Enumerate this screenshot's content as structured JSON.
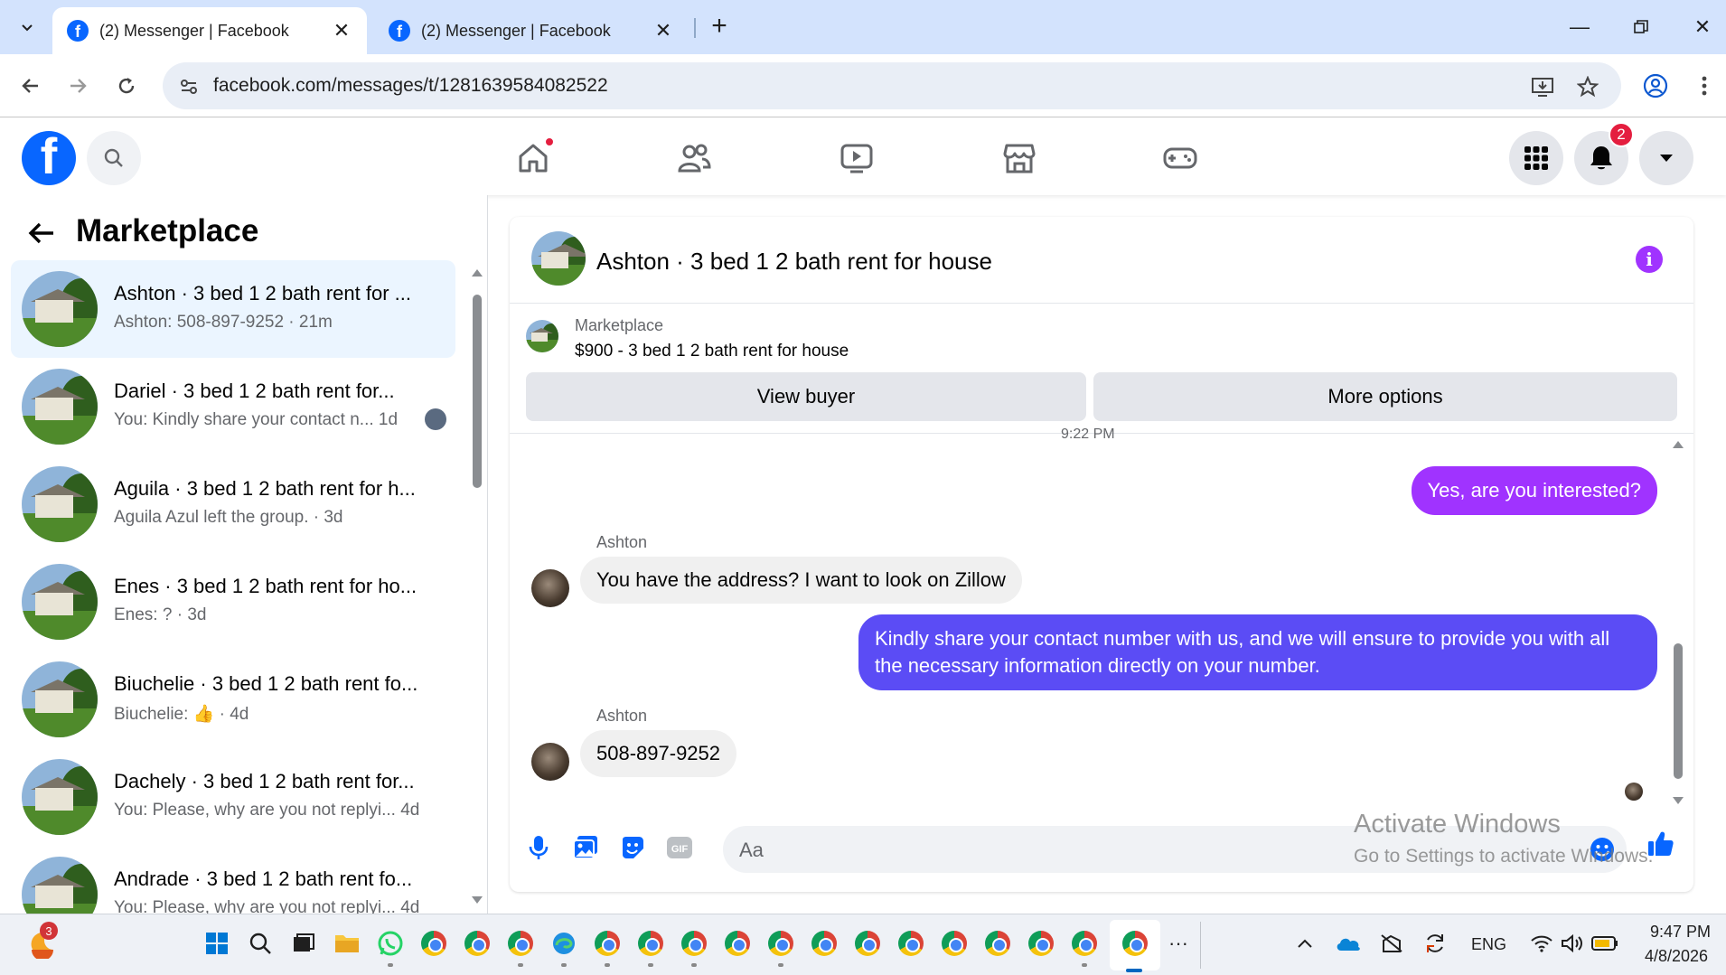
{
  "browser": {
    "tabs": [
      {
        "title": "(2) Messenger | Facebook",
        "active": true
      },
      {
        "title": "(2) Messenger | Facebook",
        "active": false
      }
    ],
    "url": "facebook.com/messages/t/1281639584082522",
    "new_tab_label": "+"
  },
  "fb": {
    "logo_letter": "f",
    "notification_count": "2",
    "accent_color": "#0866ff"
  },
  "left_panel": {
    "title": "Marketplace",
    "conversations": [
      {
        "title": "Ashton · 3 bed 1 2 bath rent for ...",
        "subtitle": "Ashton: 508-897-9252 · 21m",
        "selected": true
      },
      {
        "title": "Dariel · 3 bed 1 2 bath rent for...",
        "subtitle": "You: Kindly share your contact n...   1d",
        "selected": false
      },
      {
        "title": "Aguila · 3 bed 1 2 bath rent for h...",
        "subtitle": "Aguila Azul left the group. · 3d",
        "selected": false
      },
      {
        "title": "Enes · 3 bed 1 2 bath rent for ho...",
        "subtitle": "Enes: ? · 3d",
        "selected": false
      },
      {
        "title": "Biuchelie · 3 bed 1 2 bath rent fo...",
        "subtitle": "Biuchelie: 👍 · 4d",
        "selected": false
      },
      {
        "title": "Dachely · 3 bed 1 2 bath rent for...",
        "subtitle": "You: Please, why are you not replyi...   4d",
        "selected": false
      },
      {
        "title": "Andrade · 3 bed 1 2 bath rent fo...",
        "subtitle": "You: Please, why are you not replyi...   4d",
        "selected": false
      }
    ]
  },
  "chat": {
    "title": "Ashton · 3 bed 1 2 bath rent for house",
    "info_icon_letter": "i",
    "marketplace_label": "Marketplace",
    "listing": "$900 - 3 bed 1 2 bath rent for house",
    "view_buyer_label": "View buyer",
    "more_options_label": "More options",
    "timestamp": "9:22 PM",
    "messages": [
      {
        "direction": "out",
        "text": "Yes, are you interested?"
      },
      {
        "direction": "in",
        "sender": "Ashton",
        "text": "You have the address? I want to look on Zillow"
      },
      {
        "direction": "out",
        "text": "Kindly share your contact number with us, and we will ensure to provide you with all the necessary information directly on your number."
      },
      {
        "direction": "in",
        "sender": "Ashton",
        "text": "508-897-9252"
      }
    ],
    "composer_placeholder": "Aa",
    "outgoing_color_1": "#a033ff",
    "outgoing_color_2": "#5b4cf5"
  },
  "watermark": {
    "line1": "Activate Windows",
    "line2": "Go to Settings to activate Windows."
  },
  "taskbar": {
    "start_badge": "3",
    "tray_lang": "ENG",
    "time": "9:47 PM",
    "date": "4/8/2026",
    "overflow": "···"
  }
}
